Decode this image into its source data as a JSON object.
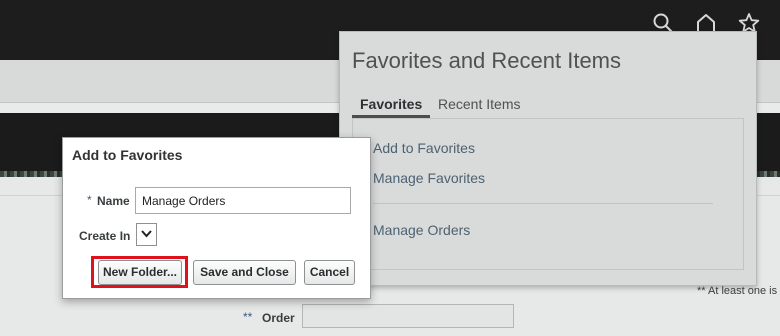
{
  "header": {
    "icons": [
      "search-icon",
      "home-icon",
      "star-icon"
    ]
  },
  "favorites_panel": {
    "title": "Favorites and Recent Items",
    "tabs": [
      {
        "label": "Favorites",
        "active": true
      },
      {
        "label": "Recent Items",
        "active": false
      }
    ],
    "links": [
      "Add to Favorites",
      "Manage Favorites",
      "Manage Orders"
    ]
  },
  "dialog": {
    "title": "Add to Favorites",
    "name_required_marker": "*",
    "name_label": "Name",
    "name_value": "Manage Orders",
    "create_in_label": "Create In",
    "buttons": {
      "new_folder": "New Folder...",
      "save_close": "Save and Close",
      "cancel": "Cancel"
    }
  },
  "page": {
    "note": "** At least one is",
    "order_required_marker": "**",
    "order_label": "Order"
  },
  "colors": {
    "highlight": "#e0101c",
    "topbar": "#1e1d1d"
  }
}
